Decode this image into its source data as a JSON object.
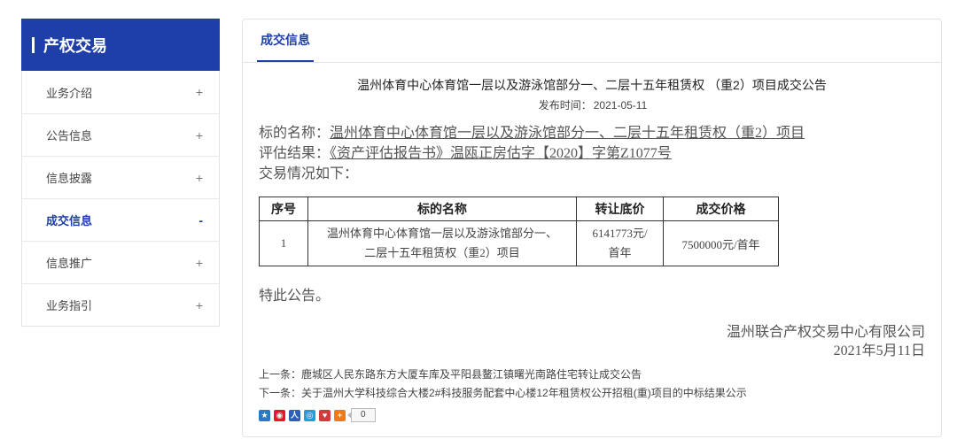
{
  "sidebar": {
    "title": "产权交易",
    "items": [
      {
        "label": "业务介绍",
        "sign": "+"
      },
      {
        "label": "公告信息",
        "sign": "+"
      },
      {
        "label": "信息披露",
        "sign": "+"
      },
      {
        "label": "成交信息",
        "sign": "-"
      },
      {
        "label": "信息推广",
        "sign": "+"
      },
      {
        "label": "业务指引",
        "sign": "+"
      }
    ]
  },
  "main": {
    "tab": "成交信息",
    "title": "温州体育中心体育馆一层以及游泳馆部分一、二层十五年租赁权 （重2）项目成交公告",
    "pubdate_label": "发布时间：",
    "pubdate": "2021-05-11",
    "subject_label": "标的名称：",
    "subject": "温州体育中心体育馆一层以及游泳馆部分一、二层十五年租赁权（重2）项目",
    "eval_label": "评估结果：",
    "eval": "《资产评估报告书》温瓯正房估字【2020】字第Z1077号",
    "deal_intro": "交易情况如下：",
    "table": {
      "headers": [
        "序号",
        "标的名称",
        "转让底价",
        "成交价格"
      ],
      "rows": [
        {
          "no": "1",
          "name_line1": "温州体育中心体育馆一层以及游泳馆部分一、",
          "name_line2": "二层十五年租赁权（重2）项目",
          "base_line1": "6141773元/",
          "base_line2": "首年",
          "price": "7500000元/首年"
        }
      ]
    },
    "notice": "特此公告。",
    "company": "温州联合产权交易中心有限公司",
    "date": "2021年5月11日",
    "prev_label": "上一条：",
    "prev": "鹿城区人民东路东方大厦车库及平阳县鳌江镇曙光南路住宅转让成交公告",
    "next_label": "下一条：",
    "next": "关于温州大学科技综合大楼2#科技服务配套中心楼12年租赁权公开招租(重)项目的中标结果公示",
    "share_count": "0"
  }
}
